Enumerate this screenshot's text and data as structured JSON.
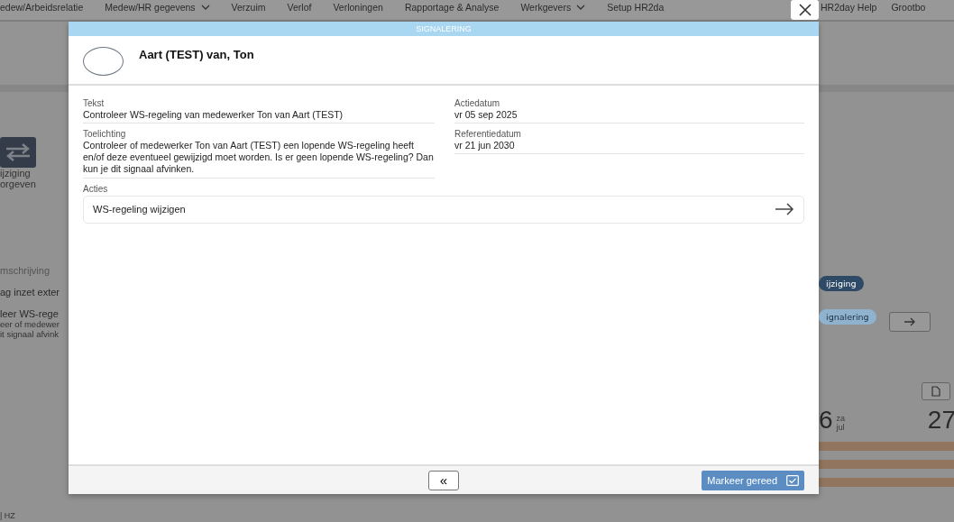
{
  "background": {
    "nav": [
      {
        "label": "edew/Arbeidsrelatie",
        "has_menu": false
      },
      {
        "label": "Medew/HR gegevens",
        "has_menu": true
      },
      {
        "label": "Verzuim",
        "has_menu": false
      },
      {
        "label": "Verlof",
        "has_menu": false
      },
      {
        "label": "Verloningen",
        "has_menu": false
      },
      {
        "label": "Rapportage & Analyse",
        "has_menu": false
      },
      {
        "label": "Werkgevers",
        "has_menu": true
      },
      {
        "label": "Setup HR2da",
        "has_menu": false
      },
      {
        "label": "HR2day Help",
        "has_menu": false
      },
      {
        "label": "Grootbo",
        "has_menu": false
      }
    ],
    "tile_lines": [
      "ijziging",
      "orgeven"
    ],
    "list_header": "mschrijving",
    "list_rows": [
      {
        "title": "ag inzet exter",
        "lines": []
      },
      {
        "title": "leer WS-rege",
        "lines": [
          "eer of medewer",
          "it signaal afvink"
        ]
      }
    ],
    "badges": [
      {
        "label": "ijziging",
        "color": "#2f4a66"
      },
      {
        "label": "ignalering",
        "color": "#8fb3cf"
      }
    ],
    "day": {
      "number": "6",
      "weekday": "za",
      "month": "jul"
    },
    "next_day": "27",
    "footer_text": "| HZ"
  },
  "dialog": {
    "title": "SIGNALERING",
    "name": "Aart (TEST) van, Ton",
    "fields": [
      {
        "label": "Tekst",
        "value": "Controleer WS-regeling van medewerker Ton van Aart (TEST)"
      },
      {
        "label": "Actiedatum",
        "value": "vr 05 sep 2025"
      },
      {
        "label": "Toelichting",
        "value": "Controleer of medewerker Ton van Aart (TEST) een lopende WS-regeling heeft en/of deze eventueel gewijzigd moet worden. Is er geen lopende WS-regeling? Dan kun je dit signaal afvinken."
      },
      {
        "label": "Referentiedatum",
        "value": "vr 21 jun 2030"
      }
    ],
    "actions_label": "Acties",
    "actions": [
      "WS-regeling wijzigen"
    ],
    "back_button": "«",
    "done_button": "Markeer gereed"
  }
}
